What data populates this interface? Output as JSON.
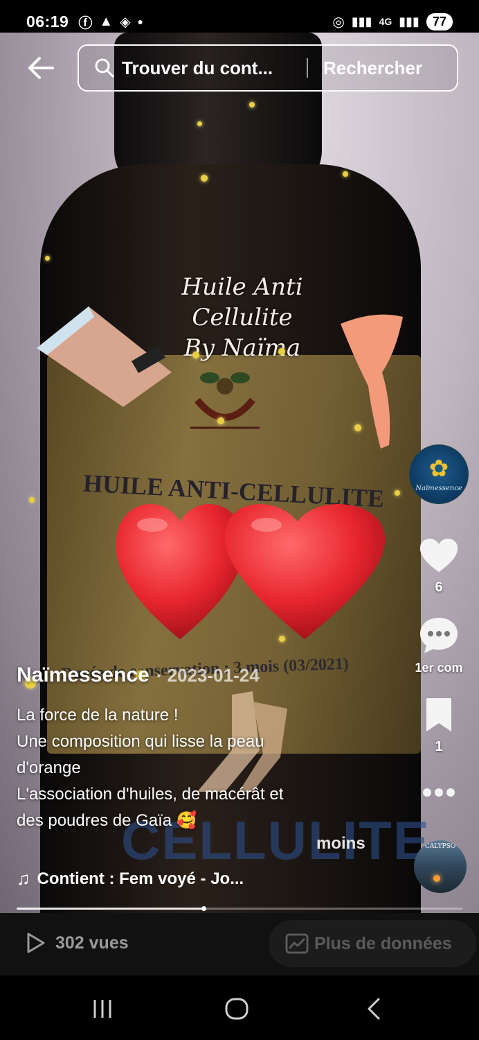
{
  "status_bar": {
    "time": "06:19",
    "icons": [
      "facebook-icon",
      "warning-icon",
      "layers-icon",
      "dot-icon"
    ],
    "network": "4G",
    "battery": "77"
  },
  "video_overlay": {
    "script_title_line1": "Huile Anti Cellulite",
    "script_title_line2": "By Naïma",
    "label_title": "HUILE ANTI-CELLULITE",
    "label_duration": "Durée de conservation : 3 mois (03/2021)",
    "big_word": "CELLULITE"
  },
  "search": {
    "placeholder": "Trouver du cont...",
    "submit_label": "Rechercher"
  },
  "rail": {
    "profile_name": "Naïmessence",
    "like_count": "6",
    "comment_label": "1er com",
    "bookmark_count": "1",
    "sound_avatar_text": "CALYPSO"
  },
  "post": {
    "author": "Naïmessence",
    "date": "· 2023-01-24",
    "caption_lines": [
      "La force de la nature !",
      "Une composition qui lisse la peau",
      "d'orange",
      "L'association d'huiles, de macérât et",
      "des poudres de Gaïa 🥰"
    ],
    "less_label": "moins",
    "music": "Contient : Fem voyé - Jo..."
  },
  "progress": {
    "fraction": 0.42
  },
  "stats": {
    "views": "302 vues",
    "more_data_label": "Plus de données"
  },
  "colors": {
    "accent_heart": "#e8262f",
    "background": "#000000"
  }
}
